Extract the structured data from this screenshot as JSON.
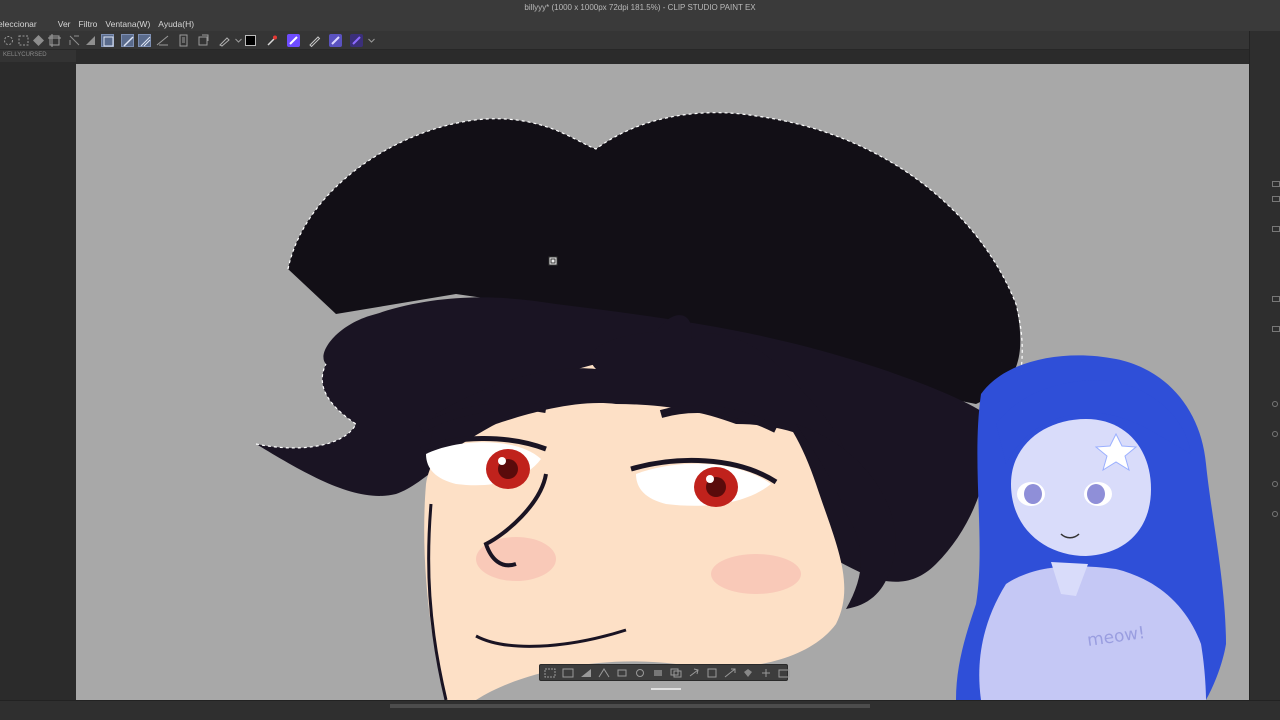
{
  "window": {
    "title": "billyyy* (1000 x 1000px 72dpi 181.5%)  - CLIP STUDIO PAINT EX"
  },
  "menu": {
    "items": [
      "eleccionar",
      "Ver",
      "Filtro",
      "Ventana(W)",
      "Ayuda(H)"
    ]
  },
  "document_tab": {
    "label": "KELLYCURSED"
  },
  "toolbar": {
    "icons": [
      "select-all-icon",
      "deselect-icon",
      "fill-icon",
      "transform-icon",
      "crop-icon",
      "expand-icon",
      "grid-icon",
      "ruler-icon",
      "snap-icon",
      "perspective-icon",
      "hand-icon",
      "color-black-icon",
      "eyedropper-icon",
      "brush-icon",
      "pen-icon"
    ],
    "active_color": "#000000",
    "accent_color": "#6e4cff"
  },
  "selection_launcher": {
    "icons": [
      "deselect-icon",
      "crop-icon",
      "invert-icon",
      "expand-icon",
      "shrink-icon",
      "fill-icon",
      "clear-icon",
      "copy-icon",
      "paste-icon",
      "transform-icon",
      "scale-icon",
      "bucket-icon",
      "more-icon"
    ]
  },
  "colors": {
    "canvas_bg": "#a8a8a8",
    "hair": "#1a1423",
    "skin": "#fde0c6",
    "iris": "#c0221c",
    "vtuber_hair": "#2f4fd8",
    "vtuber_sweater": "#c5c8f5"
  }
}
